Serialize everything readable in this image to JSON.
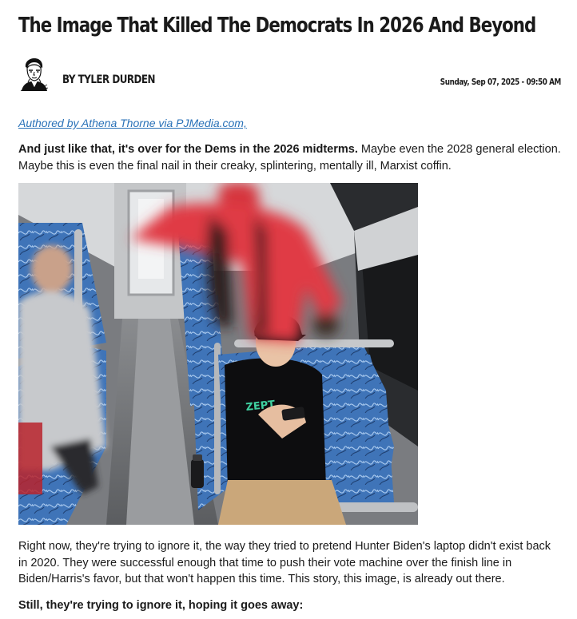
{
  "article": {
    "headline": "The Image That Killed The Democrats In 2026 And Beyond",
    "author": "By Tyler Durden",
    "date": "Sunday, Sep 07, 2025 - 09:50 AM",
    "credit_link": "Authored by Athena Thorne via PJMedia.com,",
    "intro_bold": "And just like that, it's over for the Dems in the 2026 midterms.",
    "intro_rest": " Maybe even the 2028 general election. Maybe this is even the final nail in their creaky, splintering, mentally ill, Marxist coffin.",
    "body_paragraph": "Right now, they're trying to ignore it, the way they tried to pretend Hunter Biden's laptop didn't exist back in 2020. They were successful enough that time to push their vote machine over the finish line in Biden/Harris's favor, but that won't happen this time. This story, this image, is already out there.",
    "closing_bold": "Still, they're trying to ignore it, hoping it goes away:"
  },
  "icons": {
    "author_avatar": "author-avatar-icon"
  },
  "colors": {
    "link": "#2a72b8",
    "text": "#1a1a1a",
    "background": "#ffffff"
  }
}
